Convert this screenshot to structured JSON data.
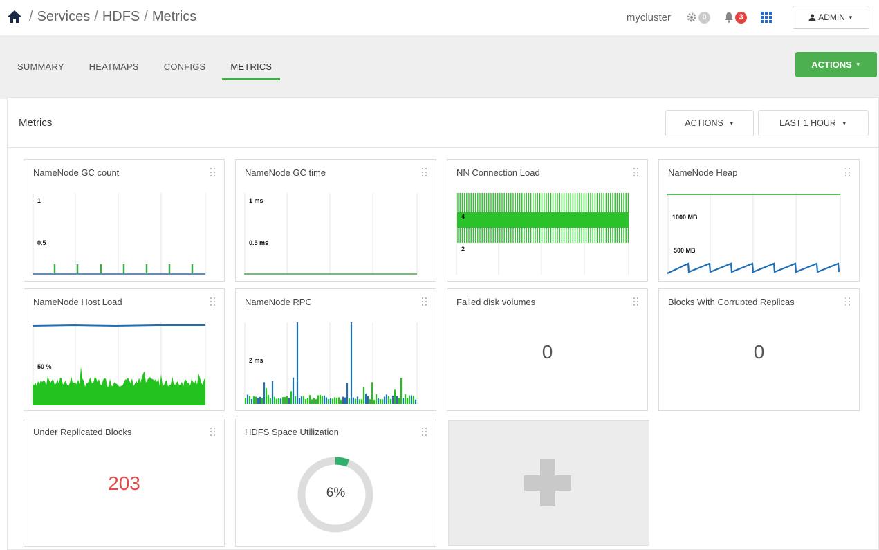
{
  "breadcrumb": {
    "services": "Services",
    "hdfs": "HDFS",
    "page": "Metrics"
  },
  "header": {
    "cluster": "mycluster",
    "ops_count": "0",
    "alerts_count": "3",
    "user": "ADMIN"
  },
  "tabs": [
    {
      "label": "SUMMARY"
    },
    {
      "label": "HEATMAPS"
    },
    {
      "label": "CONFIGS"
    },
    {
      "label": "METRICS",
      "active": true
    }
  ],
  "nav_actions": "ACTIONS",
  "panel": {
    "title": "Metrics",
    "actions_label": "ACTIONS",
    "time_label": "LAST 1 HOUR"
  },
  "colors": {
    "green": "#3fae49",
    "blue": "#1f6fb5",
    "red_badge": "#e5433f",
    "red_value": "#e24a45"
  },
  "widgets": [
    {
      "title": "NameNode GC count",
      "y_labels": [
        "1",
        "0.5"
      ]
    },
    {
      "title": "NameNode GC time",
      "y_labels": [
        "1 ms",
        "0.5 ms"
      ]
    },
    {
      "title": "NN Connection Load",
      "y_labels": [
        "4",
        "2"
      ]
    },
    {
      "title": "NameNode Heap",
      "y_labels": [
        "1000 MB",
        "500 MB"
      ]
    },
    {
      "title": "NameNode Host Load",
      "y_labels": [
        "50 %"
      ]
    },
    {
      "title": "NameNode RPC",
      "y_labels": [
        "2 ms"
      ]
    },
    {
      "title": "Failed disk volumes",
      "value": "0"
    },
    {
      "title": "Blocks With Corrupted Replicas",
      "value": "0"
    },
    {
      "title": "Under Replicated Blocks",
      "value": "203"
    },
    {
      "title": "HDFS Space Utilization",
      "value": "6%",
      "fraction": 0.06
    }
  ],
  "icons": [
    "home-icon",
    "gear-icon",
    "bell-icon",
    "apps-grid-icon",
    "user-icon",
    "drag-handle-icon",
    "plus-icon"
  ]
}
